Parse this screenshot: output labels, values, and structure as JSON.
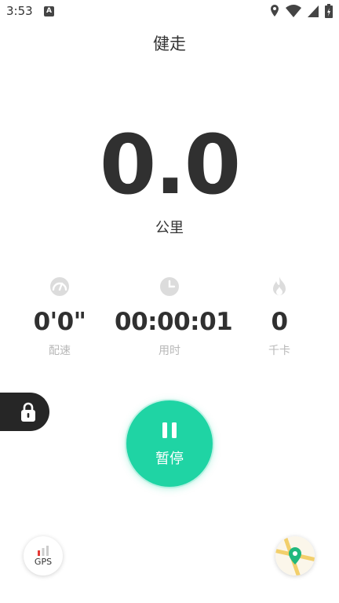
{
  "status_bar": {
    "time": "3:53",
    "notification_icon_letter": "A",
    "icons": [
      "location-icon",
      "wifi-icon",
      "signal-icon",
      "battery-charging-icon"
    ]
  },
  "header": {
    "title": "健走"
  },
  "distance": {
    "value": "0.0",
    "unit": "公里"
  },
  "stats": [
    {
      "icon": "pace-gauge-icon",
      "value": "0'0\"",
      "label": "配速"
    },
    {
      "icon": "clock-icon",
      "value": "00:00:01",
      "label": "用时"
    },
    {
      "icon": "flame-icon",
      "value": "0",
      "label": "千卡"
    }
  ],
  "controls": {
    "lock_icon": "lock-icon",
    "pause_label": "暂停",
    "gps_label": "GPS",
    "map_icon": "map-pin-icon"
  },
  "colors": {
    "accent": "#1fd4a4",
    "text_primary": "#303030",
    "text_secondary": "#b8b8b8",
    "lock_bg": "#262626",
    "gps_bar_red": "#e53935",
    "map_pin": "#1fb87e"
  }
}
